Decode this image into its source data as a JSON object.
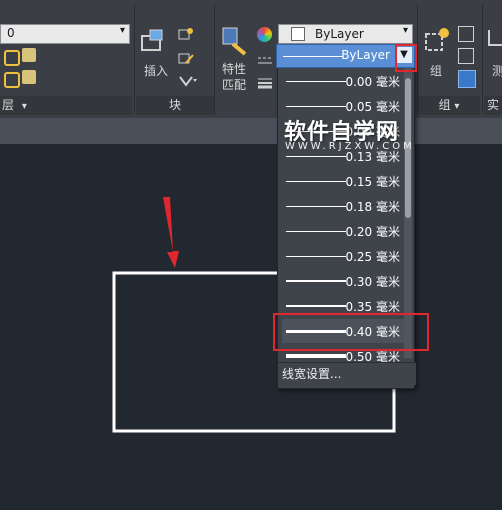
{
  "layer_combo": {
    "value": "0"
  },
  "panels": {
    "layer_label": "层",
    "block_label": "块",
    "group_label": "组",
    "utility_label": "实"
  },
  "tools": {
    "insert_label": "插入",
    "match_props_line1": "特性",
    "match_props_line2": "匹配",
    "group_label": "组",
    "measure_label": "测"
  },
  "color_combo": {
    "value": "ByLayer"
  },
  "lineweight_combo": {
    "value": "ByLayer"
  },
  "lineweights": [
    {
      "label": "0.00 毫米",
      "weight": 1
    },
    {
      "label": "0.05 毫米",
      "weight": 1
    },
    {
      "label": "0.09 毫米",
      "weight": 1
    },
    {
      "label": "0.13 毫米",
      "weight": 1
    },
    {
      "label": "0.15 毫米",
      "weight": 1
    },
    {
      "label": "0.18 毫米",
      "weight": 1
    },
    {
      "label": "0.20 毫米",
      "weight": 1
    },
    {
      "label": "0.25 毫米",
      "weight": 1
    },
    {
      "label": "0.30 毫米",
      "weight": 2
    },
    {
      "label": "0.35 毫米",
      "weight": 2
    },
    {
      "label": "0.40 毫米",
      "weight": 3
    },
    {
      "label": "0.50 毫米",
      "weight": 4
    }
  ],
  "selected_lineweight": "0.40 毫米",
  "footer": {
    "settings_label": "线宽设置..."
  },
  "watermark": {
    "title": "软件自学网",
    "url": "WWW.RJZXW.COM"
  },
  "colors": {
    "highlight_red": "#e0262e",
    "selection_blue": "#5a8fd6",
    "canvas": "#212830"
  }
}
